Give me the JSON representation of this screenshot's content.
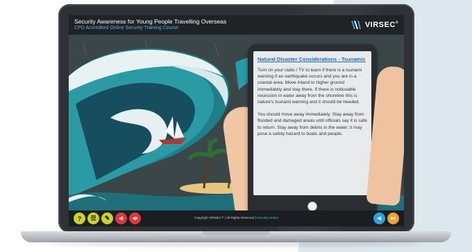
{
  "app": {
    "title": "Security Awareness for Young People Travelling Overseas",
    "subtitle": "CPD Accredited Online Security Training Course",
    "logo_text": "VIRSEC",
    "logo_mark": "®"
  },
  "tablet": {
    "heading": "Natural Disaster Considerations - Tsunamis",
    "paragraphs": [
      "Turn on your radio / TV to learn if there is a tsunami warning if an earthquake occurs and you are in a coastal area. Move inland to higher ground immediately and stay there. If there is noticeable recession in water away from the shoreline this is nature's tsunami warning and it should be heeded.",
      "You should move away immediately. Stay away from flooded and damaged areas until officials say it is safe to return. Stay away from debris in the water; it may pose a safety hazard to boats and people."
    ]
  },
  "footer": {
    "copyright": "Copyright VIRSEC™ | All Rights Reserved | ",
    "security_notice": "Security Notice",
    "help_label": "?",
    "menu_label": "☰",
    "notes_label": "✎",
    "audio_label": "◀)",
    "mute_label": "◀x",
    "back_label": "◀|",
    "next_label": "▶|"
  },
  "colors": {
    "help": "#c9d32c",
    "menu": "#c9d32c",
    "notes": "#c9d32c",
    "audio": "#e8333a",
    "mute": "#e8333a",
    "back": "#2aa3e0",
    "next": "#f0a030",
    "heading": "#1b6fb5",
    "link": "#4fb3e8"
  }
}
